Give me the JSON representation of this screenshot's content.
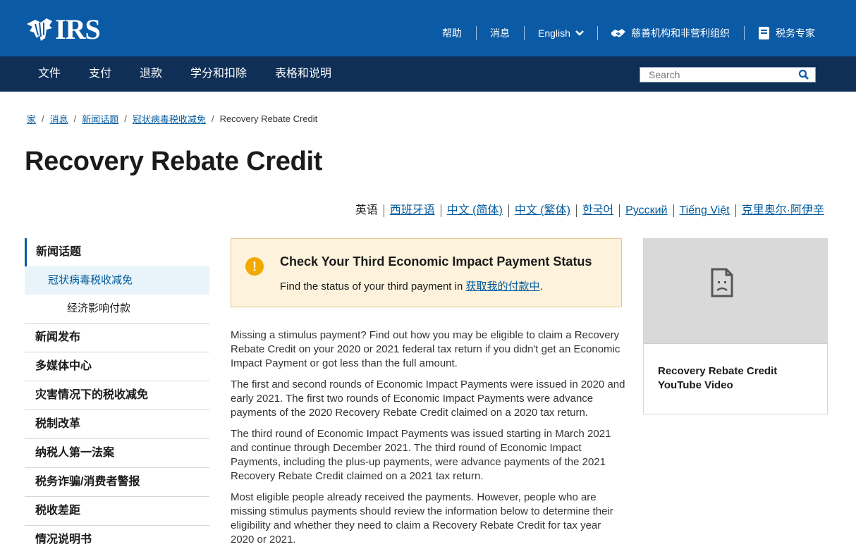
{
  "header": {
    "logo_text": "IRS",
    "utility": {
      "help": "帮助",
      "news": "消息",
      "language": "English",
      "charities": "慈善机构和非营利组织",
      "tax_pros": "税务专家"
    }
  },
  "nav": {
    "items": [
      "文件",
      "支付",
      "退款",
      "学分和扣除",
      "表格和说明"
    ],
    "search_placeholder": "Search"
  },
  "breadcrumb": {
    "items": [
      "家",
      "消息",
      "新闻话题",
      "冠状病毒税收减免"
    ],
    "current": "Recovery Rebate Credit"
  },
  "page": {
    "title": "Recovery Rebate Credit"
  },
  "languages": {
    "current": "英语",
    "links": [
      "西班牙语",
      "中文 (简体)",
      "中文 (繁体)",
      "한국어",
      "Русский",
      "Tiếng Việt",
      "克里奥尔·阿伊辛"
    ]
  },
  "sidebar": {
    "top": "新闻话题",
    "sub": "冠状病毒税收减免",
    "subsub": "经济影响付款",
    "items": [
      "新闻发布",
      "多媒体中心",
      "灾害情况下的税收减免",
      "税制改革",
      "纳税人第一法案",
      "税务诈骗/消费者警报",
      "税收差距",
      "情况说明书"
    ]
  },
  "alert": {
    "title": "Check Your Third Economic Impact Payment Status",
    "body_prefix": "Find the status of your third payment in ",
    "link": "获取我的付款中",
    "body_suffix": "."
  },
  "content": {
    "paragraphs": [
      "Missing a stimulus payment? Find out how you may be eligible to claim a Recovery Rebate Credit on your 2020 or 2021 federal tax return if you didn't get an Economic Impact Payment or got less than the full amount.",
      "The first and second rounds of Economic Impact Payments were issued in 2020 and early 2021. The first two rounds of Economic Impact Payments were advance payments of the 2020 Recovery Rebate Credit claimed on a 2020 tax return.",
      "The third round of Economic Impact Payments was issued starting in March 2021 and continue through December 2021. The third round of Economic Impact Payments, including the plus-up payments, were advance payments of the 2021 Recovery Rebate Credit claimed on a 2021 tax return.",
      "Most eligible people already received the payments. However, people who are missing stimulus payments should review the information below to determine their eligibility and whether they need to claim a Recovery Rebate Credit for tax year 2020 or 2021."
    ]
  },
  "card": {
    "title": "Recovery Rebate Credit YouTube Video",
    "media_icon": "broken-image-icon"
  },
  "colors": {
    "header_blue": "#0b5aa5",
    "nav_navy": "#0f2f57",
    "link_blue": "#00599c",
    "alert_bg": "#fdf2dc",
    "alert_icon": "#f2a900",
    "sidebar_active_bg": "#e8f4fa"
  }
}
